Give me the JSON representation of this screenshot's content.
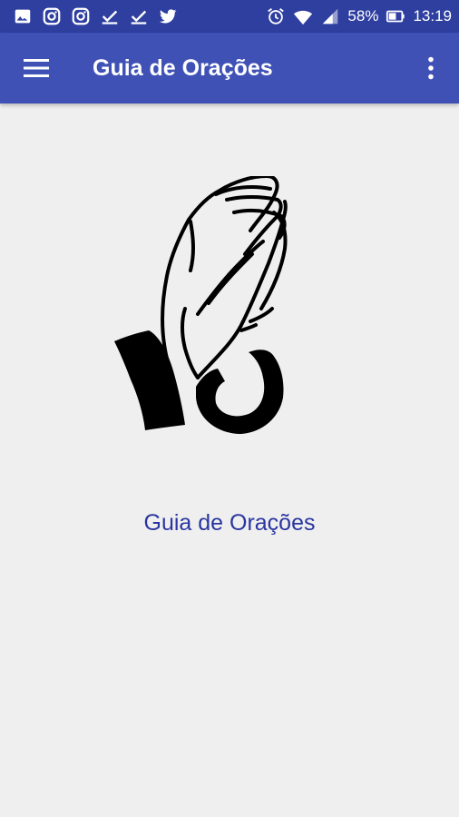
{
  "status_bar": {
    "battery_percent": "58%",
    "time": "13:19",
    "notification_icons": [
      "gallery-icon",
      "instagram-icon",
      "instagram-icon",
      "check-download-icon",
      "check-download-icon",
      "twitter-icon"
    ],
    "system_icons": [
      "alarm-icon",
      "wifi-icon",
      "signal-icon",
      "battery-icon"
    ]
  },
  "app_bar": {
    "title": "Guia de Orações",
    "menu_icon": "hamburger-menu-icon",
    "overflow_icon": "more-vert-icon"
  },
  "main": {
    "illustration": "praying-hands-icon",
    "title": "Guia de Orações"
  },
  "colors": {
    "status_bar": "#2f3fa0",
    "app_bar": "#3f51b5",
    "background": "#efefef",
    "title_text": "#2a36a0"
  }
}
